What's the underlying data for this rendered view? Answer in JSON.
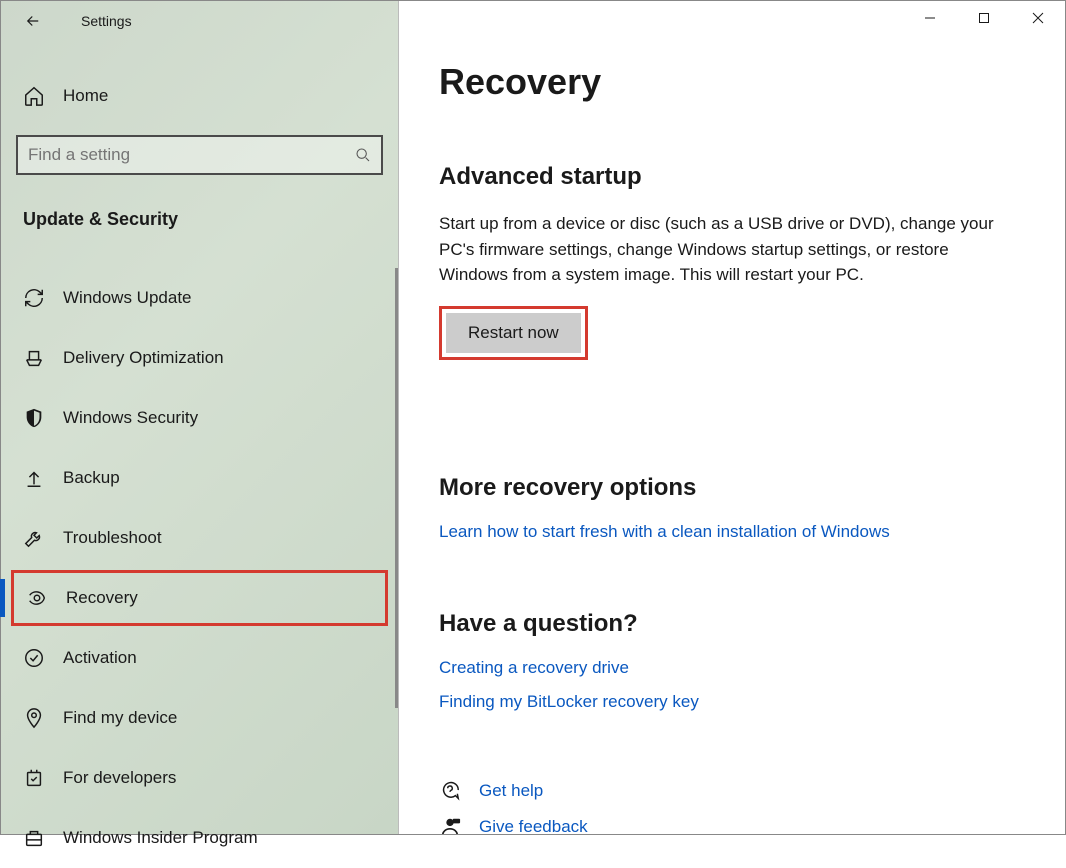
{
  "app_title": "Settings",
  "home_label": "Home",
  "search_placeholder": "Find a setting",
  "section_header": "Update & Security",
  "sidebar": {
    "items": [
      {
        "label": "Windows Update"
      },
      {
        "label": "Delivery Optimization"
      },
      {
        "label": "Windows Security"
      },
      {
        "label": "Backup"
      },
      {
        "label": "Troubleshoot"
      },
      {
        "label": "Recovery"
      },
      {
        "label": "Activation"
      },
      {
        "label": "Find my device"
      },
      {
        "label": "For developers"
      },
      {
        "label": "Windows Insider Program"
      }
    ]
  },
  "main": {
    "title": "Recovery",
    "advanced": {
      "heading": "Advanced startup",
      "description": "Start up from a device or disc (such as a USB drive or DVD), change your PC's firmware settings, change Windows startup settings, or restore Windows from a system image. This will restart your PC.",
      "button": "Restart now"
    },
    "more": {
      "heading": "More recovery options",
      "link": "Learn how to start fresh with a clean installation of Windows"
    },
    "question": {
      "heading": "Have a question?",
      "links": [
        "Creating a recovery drive",
        "Finding my BitLocker recovery key"
      ]
    },
    "footer": {
      "help": "Get help",
      "feedback": "Give feedback"
    }
  }
}
